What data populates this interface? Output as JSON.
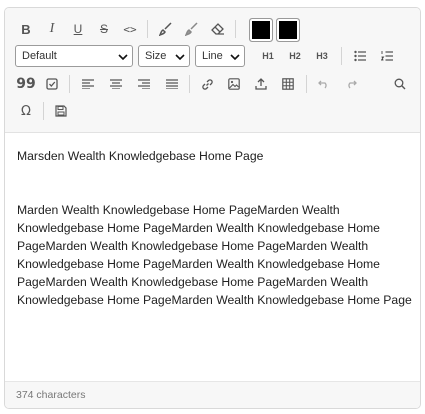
{
  "toolbar": {
    "font_select": "Default",
    "size_select": "Size",
    "line_select": "Line",
    "h1_label": "H1",
    "h2_label": "H2",
    "h3_label": "H3",
    "text_color": "#000000",
    "highlight_color": "#000000",
    "icons": [
      "bold-icon",
      "italic-icon",
      "underline-icon",
      "strikethrough-icon",
      "code-icon",
      "brush-icon",
      "fill-icon",
      "eraser-icon",
      "bulleted-list-icon",
      "numbered-list-icon",
      "quote-icon",
      "checkbox-icon",
      "align-left-icon",
      "align-center-icon",
      "align-right-icon",
      "justify-icon",
      "link-icon",
      "image-icon",
      "upload-icon",
      "table-icon",
      "undo-icon",
      "redo-icon",
      "search-icon",
      "omega-icon",
      "save-icon"
    ]
  },
  "content": {
    "title_line": "Marsden Wealth Knowledgebase Home Page",
    "paragraph_lines": [
      "Marden Wealth Knowledgebase Home PageMarden Wealth",
      "Knowledgebase Home PageMarden Wealth Knowledgebase Home",
      "PageMarden Wealth Knowledgebase Home PageMarden Wealth",
      "Knowledgebase Home PageMarden Wealth Knowledgebase Home",
      "PageMarden Wealth Knowledgebase Home PageMarden Wealth",
      "Knowledgebase Home PageMarden Wealth Knowledgebase Home Page"
    ]
  },
  "footer": {
    "char_count": "374 characters"
  }
}
